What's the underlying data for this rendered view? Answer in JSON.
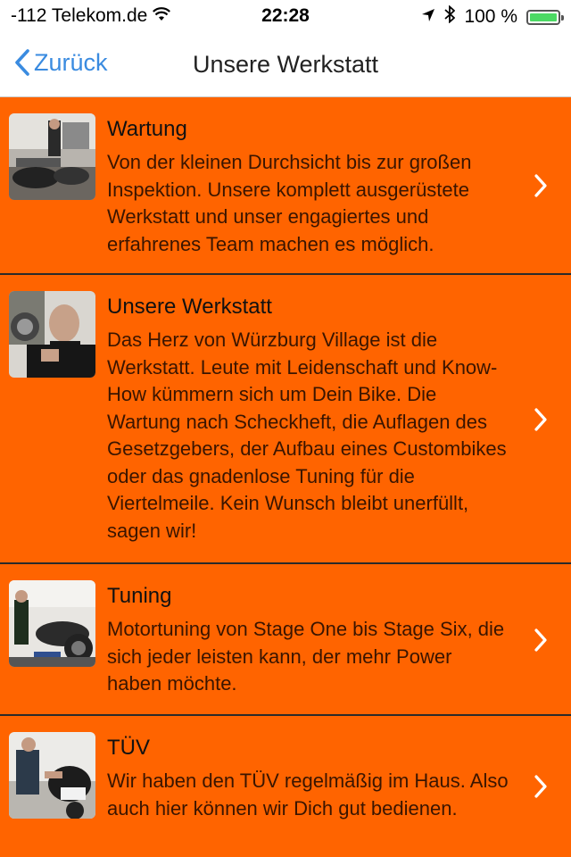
{
  "status_bar": {
    "carrier": "-112 Telekom.de",
    "time": "22:28",
    "battery": "100 %",
    "battery_level": 1.0
  },
  "nav": {
    "back_label": "Zurück",
    "title": "Unsere Werkstatt"
  },
  "items": [
    {
      "title": "Wartung",
      "text": "Von der kleinen Durchsicht bis zur großen Inspektion. Unsere komplett ausgerüstete Werkstatt und unser engagiertes und erfahrenes Team machen es möglich."
    },
    {
      "title": "Unsere Werkstatt",
      "text": "Das Herz von Würzburg Village ist die Werkstatt. Leute mit Leidenschaft und Know-How kümmern sich um Dein Bike. Die Wartung nach Scheckheft, die Auflagen des Gesetzgebers, der Aufbau eines Custombikes oder das gnadenlose Tuning für die Viertelmeile. Kein Wunsch bleibt unerfüllt, sagen wir!"
    },
    {
      "title": "Tuning",
      "text": "Motortuning von Stage One bis Stage Six, die sich jeder leisten kann, der mehr Power haben möchte."
    },
    {
      "title": "TÜV",
      "text": "Wir haben den TÜV regelmäßig im Haus. Also auch hier können wir Dich gut bedienen."
    }
  ],
  "colors": {
    "background": "#ff6400",
    "accent": "#3a8be0",
    "battery": "#4cd964"
  }
}
